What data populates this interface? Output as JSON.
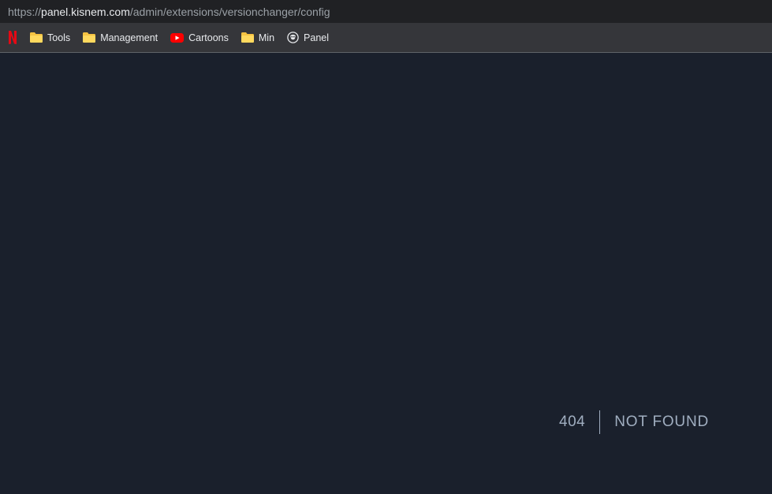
{
  "browser": {
    "url": {
      "scheme": "https://",
      "domain": "panel.kisnem.com",
      "path": "/admin/extensions/versionchanger/config"
    },
    "bookmarks": [
      {
        "label": "Tools",
        "icon": "folder-icon"
      },
      {
        "label": "Management",
        "icon": "folder-icon"
      },
      {
        "label": "Cartoons",
        "icon": "youtube-icon"
      },
      {
        "label": "Min",
        "icon": "folder-icon"
      },
      {
        "label": "Panel",
        "icon": "panel-logo-icon"
      }
    ]
  },
  "error": {
    "code": "404",
    "message": "NOT FOUND"
  },
  "colors": {
    "background": "#1a202c",
    "text": "#a0aec0",
    "netflix": "#e50914",
    "youtube": "#ff0000",
    "folder": "#f6c343"
  }
}
